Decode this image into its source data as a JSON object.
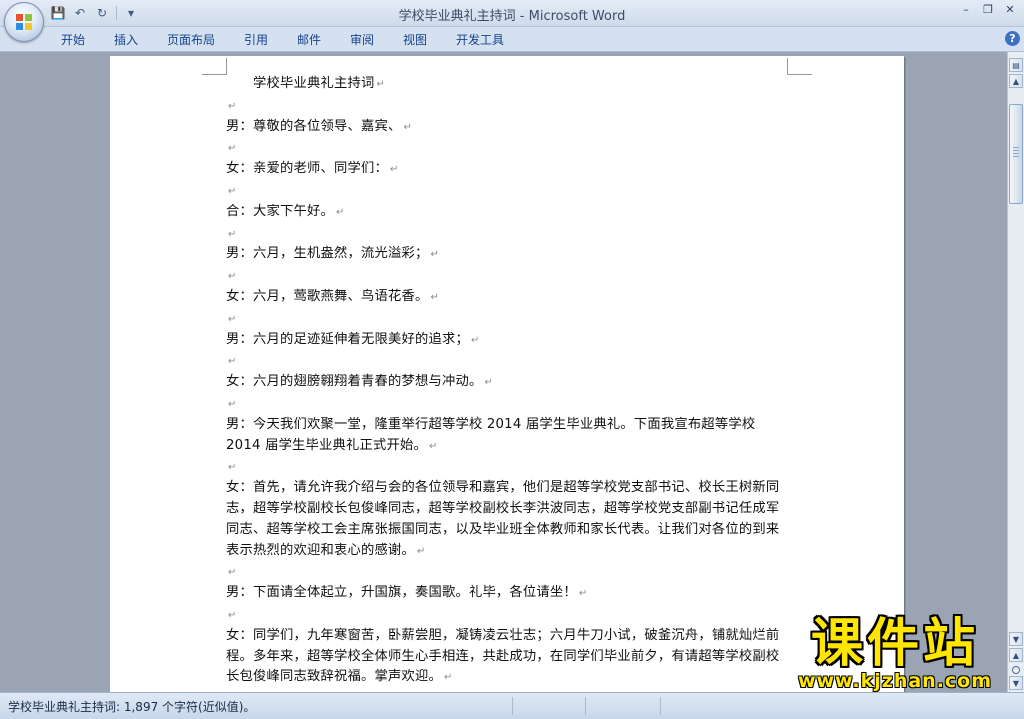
{
  "window": {
    "title": "学校毕业典礼主持词",
    "app_name": "Microsoft Word",
    "title_separator": " - "
  },
  "quick_access": [
    {
      "name": "save-icon",
      "glyph": "💾"
    },
    {
      "name": "undo-icon",
      "glyph": "↶"
    },
    {
      "name": "redo-icon",
      "glyph": "↻"
    },
    {
      "name": "customize-icon",
      "glyph": "▾"
    }
  ],
  "window_controls": {
    "minimize": "–",
    "restore": "❐",
    "close": "✕"
  },
  "ribbon_tabs": [
    "开始",
    "插入",
    "页面布局",
    "引用",
    "邮件",
    "审阅",
    "视图",
    "开发工具"
  ],
  "help_label": "?",
  "document": {
    "paragraph_mark": "↵",
    "title": "学校毕业典礼主持词",
    "lines": [
      "男：尊敬的各位领导、嘉宾、",
      "女：亲爱的老师、同学们：",
      "合：大家下午好。",
      "男：六月，生机盎然，流光溢彩；",
      "女：六月，莺歌燕舞、鸟语花香。",
      "男：六月的足迹延伸着无限美好的追求；",
      "女：六月的翅膀翱翔着青春的梦想与冲动。",
      "男：今天我们欢聚一堂，隆重举行超等学校 2014 届学生毕业典礼。下面我宣布超等学校 2014 届学生毕业典礼正式开始。",
      "女：首先，请允许我介绍与会的各位领导和嘉宾，他们是超等学校党支部书记、校长王树新同志，超等学校副校长包俊峰同志，超等学校副校长李洪波同志，超等学校党支部副书记任成军同志、超等学校工会主席张振国同志，以及毕业班全体教师和家长代表。让我们对各位的到来表示热烈的欢迎和衷心的感谢。",
      "男：下面请全体起立，升国旗，奏国歌。礼毕，各位请坐！",
      "女：同学们，九年寒窗苦，卧薪尝胆，凝铸凌云壮志；六月牛刀小试，破釜沉舟，铺就灿烂前程。多年来，超等学校全体师生心手相连，共赴成功，在同学们毕业前夕，有请超等学校副校长包俊峰同志致辞祝福。掌声欢迎。"
    ]
  },
  "status_bar": {
    "text": "学校毕业典礼主持词: 1,897 个字符(近似值)。"
  },
  "watermark": {
    "title": "课件站",
    "url": "www.kjzhan.com"
  }
}
